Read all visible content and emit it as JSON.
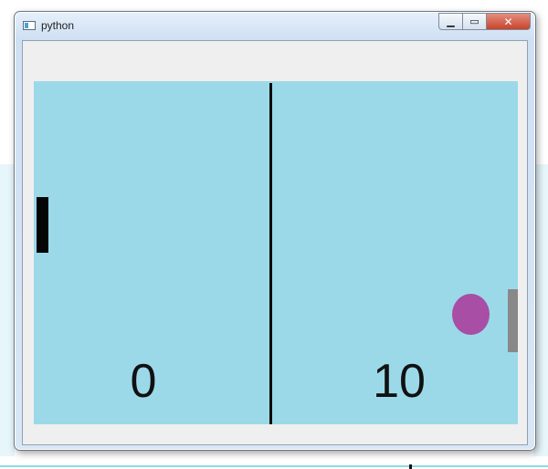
{
  "window": {
    "title": "python",
    "caption_buttons": {
      "minimize_icon": "minimize-icon",
      "maximize_icon": "maximize-icon",
      "close_icon": "close-icon"
    }
  },
  "game": {
    "scores": {
      "left": "0",
      "right": "10"
    }
  }
}
